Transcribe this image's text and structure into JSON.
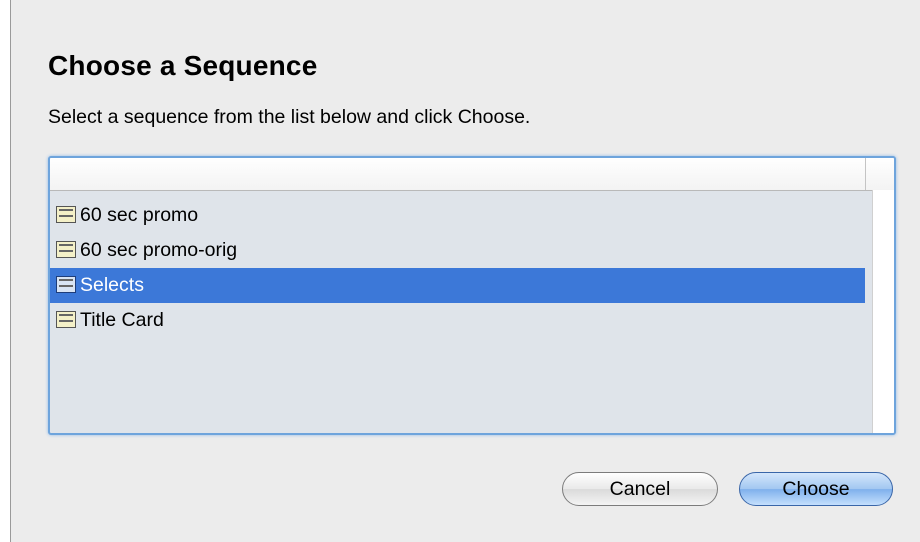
{
  "dialog": {
    "title": "Choose a Sequence",
    "subtitle": "Select a sequence from the list below and click Choose."
  },
  "list": {
    "items": [
      {
        "label": "60 sec promo",
        "icon": "sequence-icon",
        "selected": false
      },
      {
        "label": "60 sec promo-orig",
        "icon": "sequence-icon",
        "selected": false
      },
      {
        "label": "Selects",
        "icon": "sequence-icon",
        "selected": true
      },
      {
        "label": "Title Card",
        "icon": "sequence-icon",
        "selected": false
      }
    ]
  },
  "buttons": {
    "cancel_label": "Cancel",
    "choose_label": "Choose"
  },
  "colors": {
    "selection": "#3c78d8",
    "focus_ring": "#6ea4dc",
    "list_background": "#dfe4ea",
    "default_button": "#7fb0ec"
  }
}
